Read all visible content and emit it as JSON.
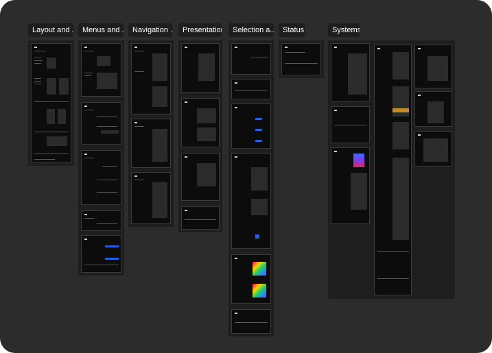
{
  "canvas": {
    "background": "#2c2c2c"
  },
  "sections": [
    {
      "id": "layout",
      "label": "Layout and ..."
    },
    {
      "id": "menus",
      "label": "Menus and ..."
    },
    {
      "id": "navigation",
      "label": "Navigation ..."
    },
    {
      "id": "presentation",
      "label": "Presentation"
    },
    {
      "id": "selection",
      "label": "Selection a..."
    },
    {
      "id": "status",
      "label": "Status"
    },
    {
      "id": "systems",
      "label": "Systems"
    }
  ],
  "accent_colors": {
    "blue": "#1f5fe6",
    "frame": "#0c0c0c",
    "board": "#1e1e1e"
  }
}
